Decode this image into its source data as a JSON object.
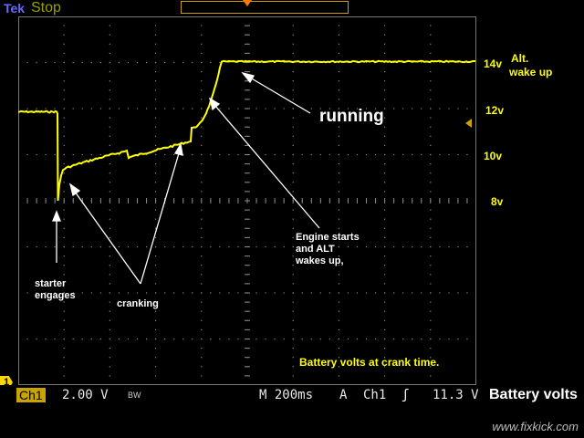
{
  "header": {
    "brand": "Tek",
    "status": "Stop"
  },
  "scale_labels": [
    "14v",
    "12v",
    "10v",
    "8v"
  ],
  "alt_label": [
    "Alt.",
    "wake up"
  ],
  "annotations": {
    "running": "running",
    "engine_starts": [
      "Engine starts",
      "and ALT",
      "wakes up,"
    ],
    "starter": [
      "starter",
      "engages"
    ],
    "cranking": "cranking",
    "caption": "Battery volts at crank time."
  },
  "footer": {
    "channel": "Ch1",
    "volts_div": "2.00 V",
    "bw": "BW",
    "timebase": "M 200ms",
    "trig_mode": "A",
    "trig_channel": "Ch1",
    "trig_slope": "ʃ",
    "trig_level": "11.3 V",
    "title": "Battery volts",
    "watermark": "www.fixkick.com"
  },
  "marker": "1",
  "colors": {
    "trace": "#ffff00",
    "grid": "#9a9a9a",
    "accent": "#c9a100",
    "trigger": "#ff7a00"
  },
  "trace_volts": {
    "resting": 11.9,
    "crank_dip_min": 8.0,
    "cranking_start": 9.5,
    "cranking_end": 10.6,
    "alternator": 14.1
  }
}
